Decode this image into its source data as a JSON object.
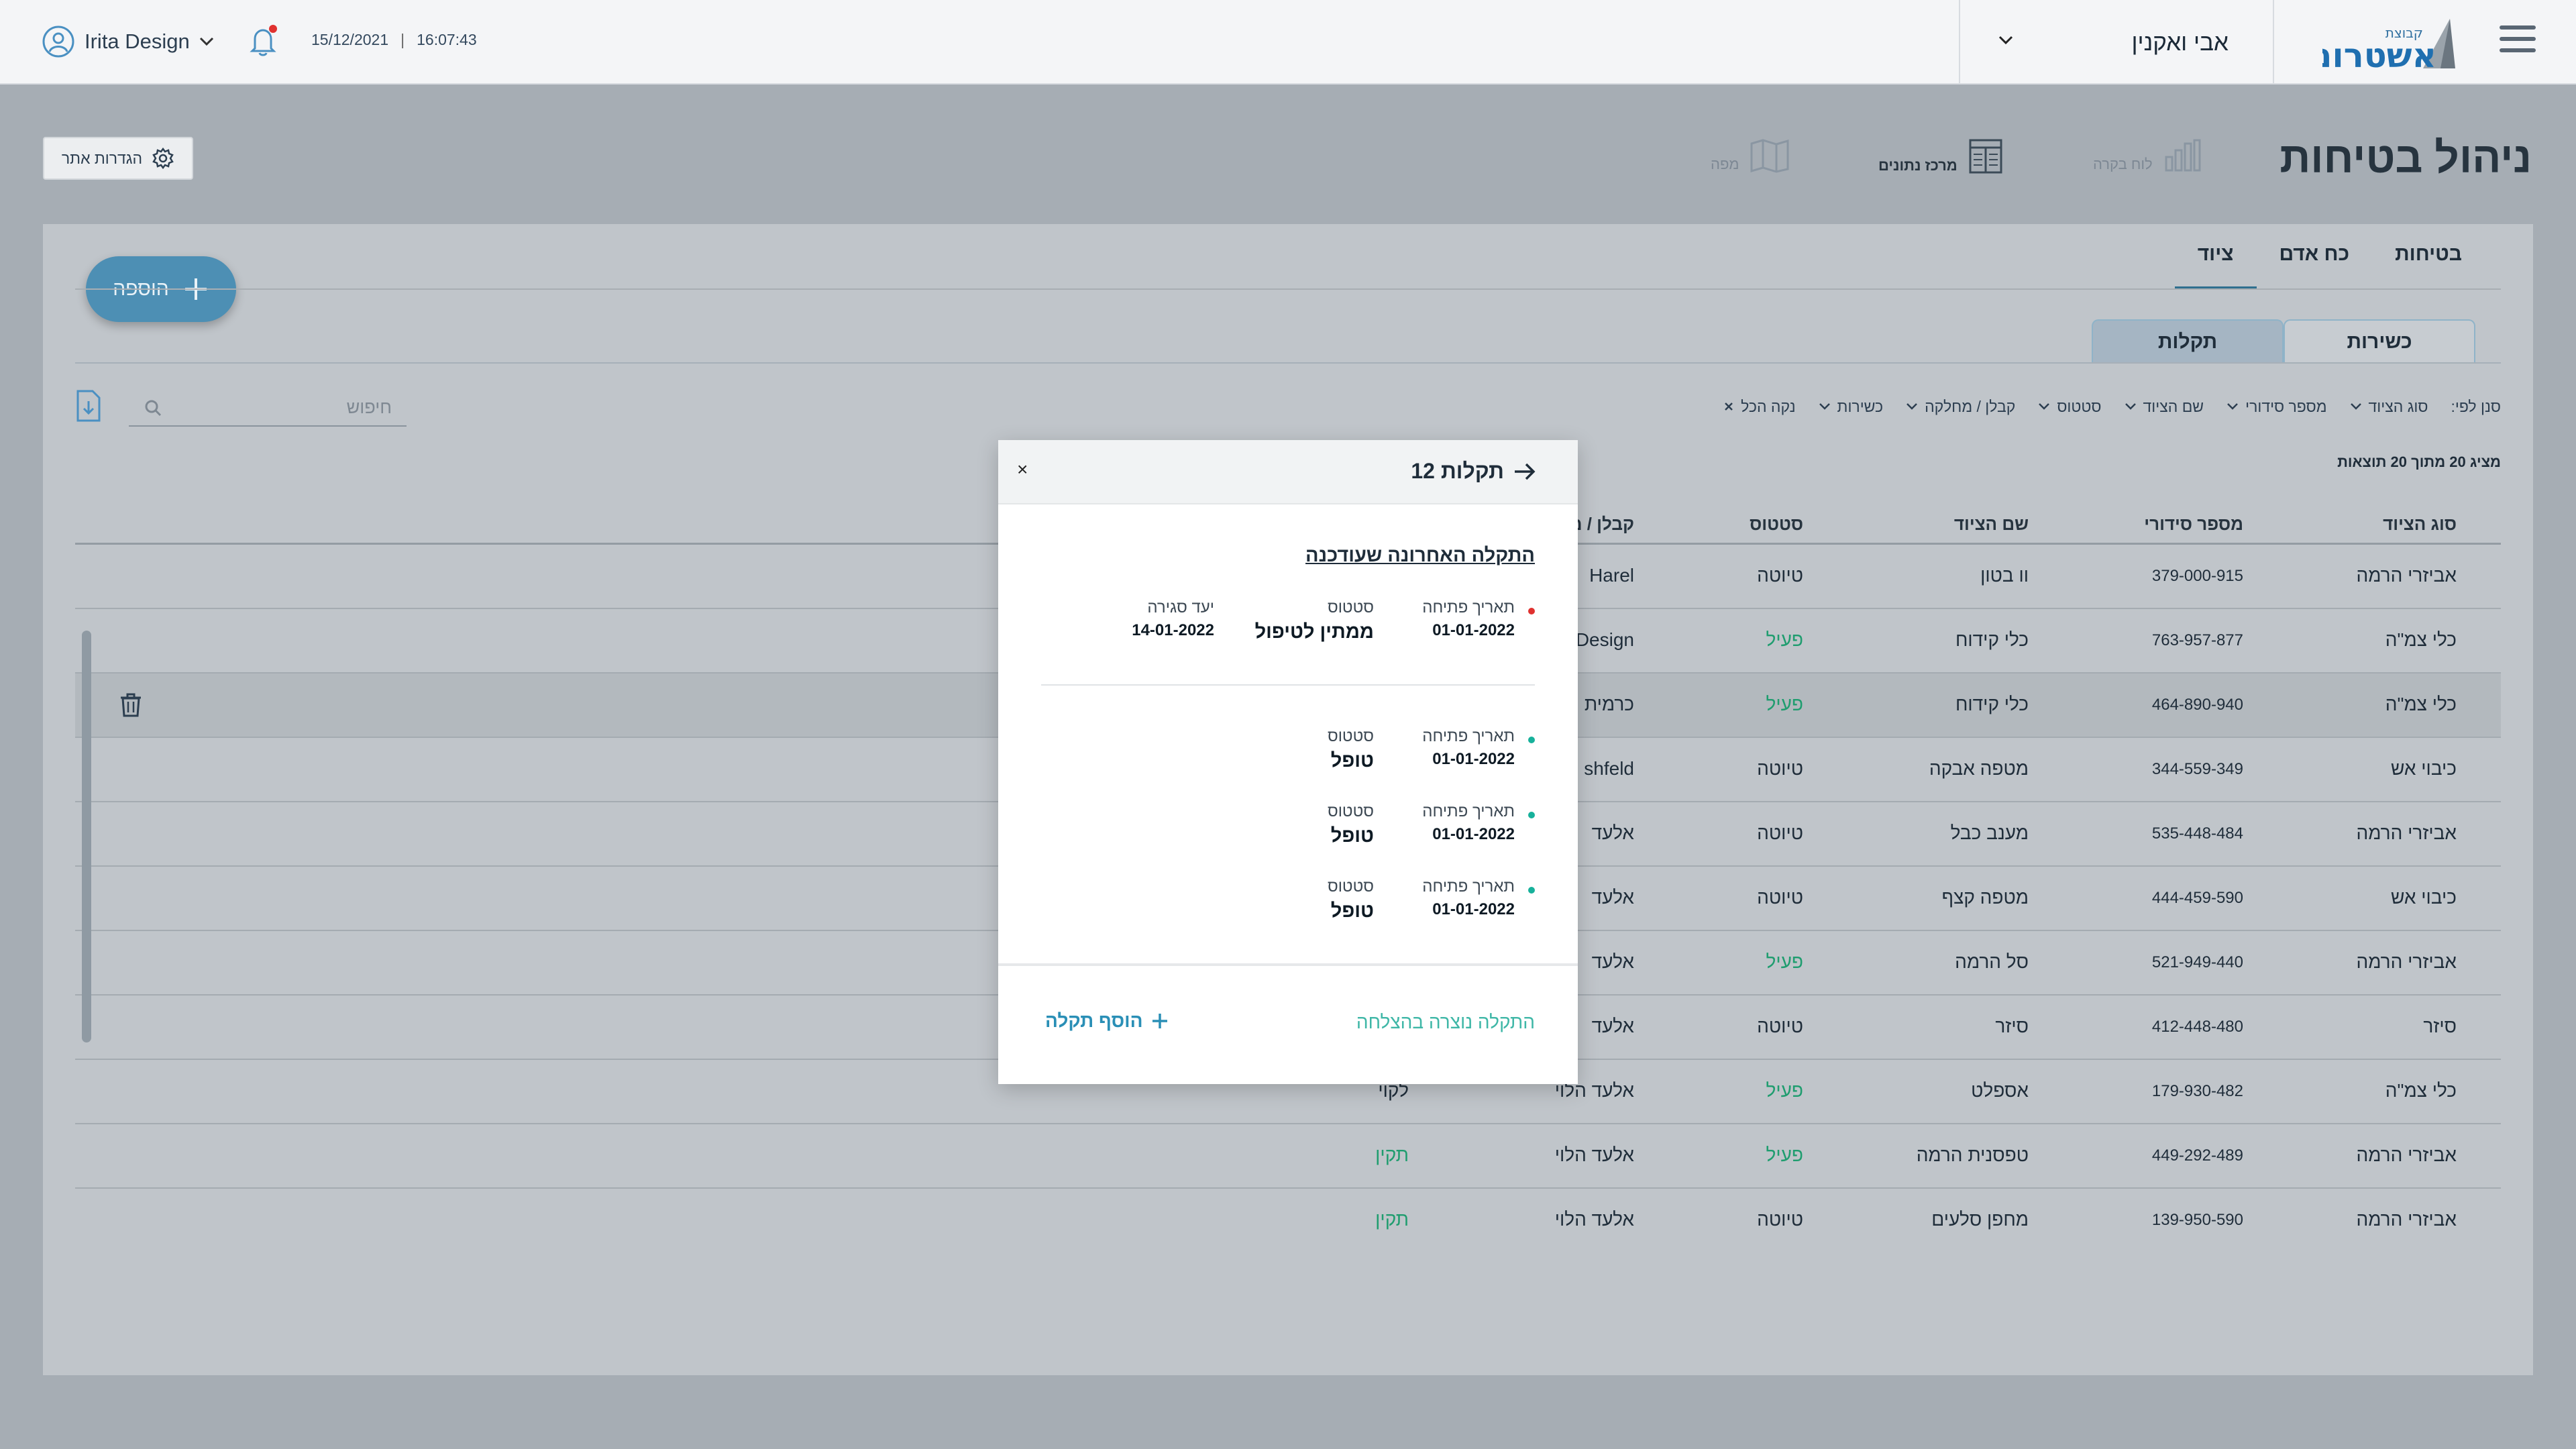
{
  "topbar": {
    "user_name": "Irita Design",
    "date": "15/12/2021",
    "separator": "|",
    "time": "16:07:43",
    "site_name": "אבי ואקנין",
    "logo_main": "אשטרום",
    "logo_small": "קבוצת"
  },
  "header": {
    "title": "ניהול בטיחות",
    "quick_links": {
      "reports": "לוח בקרה",
      "data_center": "מרכז נתונים",
      "map": "מפה"
    },
    "settings_label": "הגדרות אתר"
  },
  "card": {
    "add_label": "הוספה",
    "tabs": [
      "בטיחות",
      "כח אדם",
      "ציוד"
    ],
    "sub_tabs": [
      "כשירות",
      "תקלות"
    ],
    "filter_by": "סנן לפי:",
    "filters": [
      "סוג הציוד",
      "מספר סידורי",
      "שם הציוד",
      "סטטוס",
      "קבלן / מחלקה",
      "כשירות"
    ],
    "clear_all": "נקה הכל",
    "search_placeholder": "חיפוש",
    "results": "מציג 20 מתוך 20 תוצאות"
  },
  "table": {
    "headers": [
      "סוג הציוד",
      "מספר סידורי",
      "שם הציוד",
      "סטטוס",
      "קבלן / מ"
    ],
    "rows": [
      {
        "type": "אביזרי הרמה",
        "serial": "379-000-915",
        "name": "וו בטון",
        "status": "טיוטה",
        "contractor": "Harel",
        "fitness": ""
      },
      {
        "type": "כלי צמ\"ה",
        "serial": "763-957-877",
        "name": "כלי קידוח",
        "status": "פעיל",
        "contractor": "Design",
        "fitness": ""
      },
      {
        "type": "כלי צמ\"ה",
        "serial": "464-890-940",
        "name": "כלי קידוח",
        "status": "פעיל",
        "contractor": "כרמית",
        "fitness": ""
      },
      {
        "type": "כיבוי אש",
        "serial": "344-559-349",
        "name": "מטפה אבקה",
        "status": "טיוטה",
        "contractor": "shfeld",
        "fitness": ""
      },
      {
        "type": "אביזרי הרמה",
        "serial": "535-448-484",
        "name": "מענב כבל",
        "status": "טיוטה",
        "contractor": "אלעד",
        "fitness": ""
      },
      {
        "type": "כיבוי אש",
        "serial": "444-459-590",
        "name": "מטפה קצף",
        "status": "טיוטה",
        "contractor": "אלעד",
        "fitness": ""
      },
      {
        "type": "אביזרי הרמה",
        "serial": "521-949-440",
        "name": "סל הרמה",
        "status": "פעיל",
        "contractor": "אלעד",
        "fitness": ""
      },
      {
        "type": "סיזר",
        "serial": "412-448-480",
        "name": "סיזר",
        "status": "טיוטה",
        "contractor": "אלעד",
        "fitness": ""
      },
      {
        "type": "כלי צמ\"ה",
        "serial": "179-930-482",
        "name": "אספלט",
        "status": "פעיל",
        "contractor": "אלעד הלוי",
        "fitness": "לקוי"
      },
      {
        "type": "אביזרי הרמה",
        "serial": "449-292-489",
        "name": "טפסנית הרמה",
        "status": "פעיל",
        "contractor": "אלעד הלוי",
        "fitness": "תקין"
      },
      {
        "type": "אביזרי הרמה",
        "serial": "139-950-590",
        "name": "מחפן סלעים",
        "status": "טיוטה",
        "contractor": "אלעד הלוי",
        "fitness": "תקין"
      }
    ]
  },
  "popup": {
    "title": "תקלות 12",
    "close": "×",
    "latest_link": "התקלה האחרונה שעודכנה",
    "latest": {
      "open_label": "תאריך פתיחה",
      "open_date": "01-01-2022",
      "status_label": "סטטוס",
      "status": "ממתין לטיפול",
      "due_label": "יעד סגירה",
      "due_date": "14-01-2022"
    },
    "entries": [
      {
        "open_label": "תאריך פתיחה",
        "open_date": "01-01-2022",
        "status_label": "סטטוס",
        "status": "טופל"
      },
      {
        "open_label": "תאריך פתיחה",
        "open_date": "01-01-2022",
        "status_label": "סטטוס",
        "status": "טופל"
      },
      {
        "open_label": "תאריך פתיחה",
        "open_date": "01-01-2022",
        "status_label": "סטטוס",
        "status": "טופל"
      }
    ],
    "success_message": "התקלה נוצרה בהצלחה",
    "add_label": "הוסף תקלה"
  },
  "colors": {
    "accent": "#4d8fb4",
    "active_status": "#1f9d6f",
    "success": "#3fb7a7",
    "alert_dot": "#e0312f"
  }
}
